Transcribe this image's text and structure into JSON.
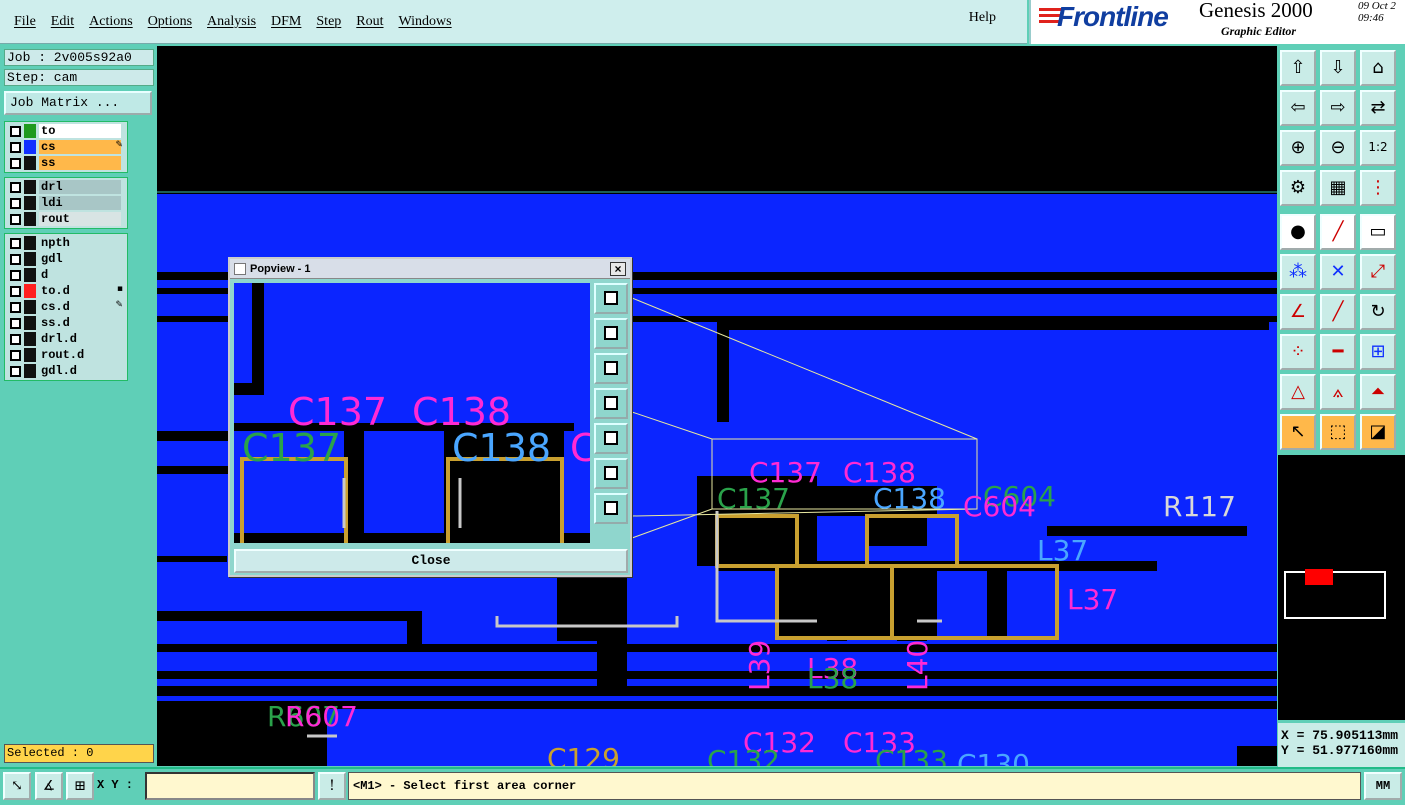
{
  "menu": [
    "File",
    "Edit",
    "Actions",
    "Options",
    "Analysis",
    "DFM",
    "Step",
    "Rout",
    "Windows"
  ],
  "help_label": "Help",
  "brand": {
    "logo": "Frontline",
    "product": "Genesis 2000",
    "subtitle": "Graphic Editor",
    "date_line1": "09 Oct 2",
    "date_line2": "09:46"
  },
  "job": "Job : 2v005s92a0",
  "step": "Step: cam",
  "job_matrix": "Job Matrix ...",
  "layer_groups": [
    [
      {
        "name": "to",
        "swatch": "#1f9a1f",
        "bg": "#ffffff",
        "mark": ""
      },
      {
        "name": "cs",
        "swatch": "#1030ff",
        "bg": "#ffb84a",
        "mark": "✎"
      },
      {
        "name": "ss",
        "swatch": "#111111",
        "bg": "#ffb84a",
        "mark": ""
      }
    ],
    [
      {
        "name": "drl",
        "swatch": "#111111",
        "bg": "#a8c6c6",
        "mark": ""
      },
      {
        "name": "ldi",
        "swatch": "#111111",
        "bg": "#a8c6c6",
        "mark": ""
      },
      {
        "name": "rout",
        "swatch": "#111111",
        "bg": "#d8e4e4",
        "mark": ""
      }
    ],
    [
      {
        "name": "npth",
        "swatch": "#111111",
        "bg": "#bfe3e0",
        "mark": ""
      },
      {
        "name": "gdl",
        "swatch": "#111111",
        "bg": "#bfe3e0",
        "mark": ""
      },
      {
        "name": "d",
        "swatch": "#111111",
        "bg": "#bfe3e0",
        "mark": ""
      },
      {
        "name": "to.d",
        "swatch": "#ff2020",
        "bg": "#bfe3e0",
        "mark": "▪"
      },
      {
        "name": "cs.d",
        "swatch": "#111111",
        "bg": "#bfe3e0",
        "mark": "✎"
      },
      {
        "name": "ss.d",
        "swatch": "#111111",
        "bg": "#bfe3e0",
        "mark": ""
      },
      {
        "name": "drl.d",
        "swatch": "#111111",
        "bg": "#bfe3e0",
        "mark": ""
      },
      {
        "name": "rout.d",
        "swatch": "#111111",
        "bg": "#bfe3e0",
        "mark": ""
      },
      {
        "name": "gdl.d",
        "swatch": "#111111",
        "bg": "#bfe3e0",
        "mark": ""
      }
    ]
  ],
  "selected": "Selected : 0",
  "popview": {
    "title": "Popview - 1",
    "close_label": "Close",
    "labels": {
      "c137_mag": "C137",
      "c138_mag": "C138",
      "c137_grn": "C137",
      "c138_grn": "C138",
      "c_partial": "C"
    }
  },
  "canvas_labels": {
    "c137_mag": "C137",
    "c138_mag": "C138",
    "c137_grn": "C137",
    "c138_grn": "C138",
    "c604_grn": "C604",
    "c604_mag": "C604",
    "r117": "R117",
    "l37_cyan": "L37",
    "l37_mag": "L37",
    "l39": "L39",
    "l38_mag": "L38",
    "l38_grn": "L38",
    "l40": "L40",
    "r607_grn": "R607",
    "r607_mag": "R607",
    "c132": "C132",
    "c133": "C133",
    "c129": "C129",
    "c132b": "C132",
    "c133b": "C133",
    "c130": "C130"
  },
  "colors": {
    "copper": "#0b25ff",
    "trace": "#000000",
    "label_magenta": "#ff2ad4",
    "label_green": "#2aa24a",
    "label_cyan": "#4aa6ff",
    "pad_gold": "#c9a030"
  },
  "coords": {
    "x": "X = 75.905113mm",
    "y": "Y = 51.977160mm"
  },
  "xy_label": "X Y :",
  "xy_value": "",
  "message": "<M1> - Select first area corner",
  "units": "MM"
}
